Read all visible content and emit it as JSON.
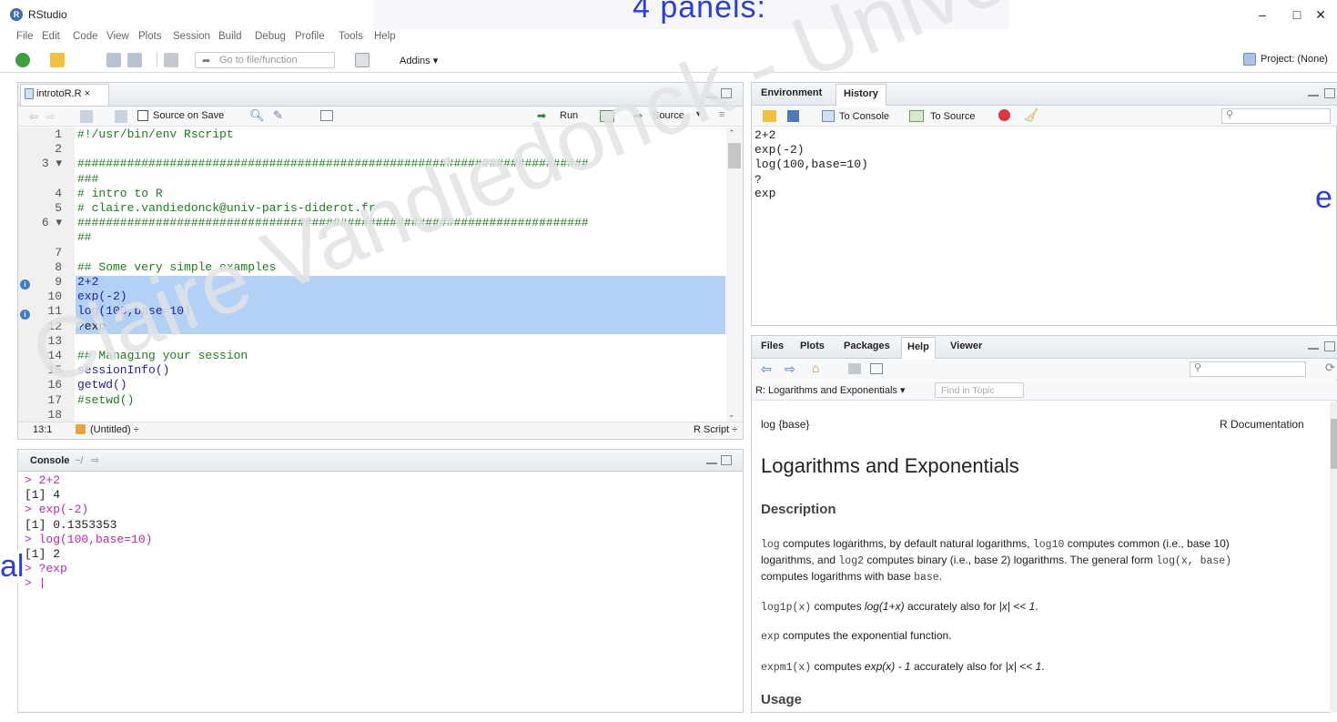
{
  "window": {
    "title": "RStudio",
    "app_icon": "R",
    "overlay_title": "4 panels:",
    "minimize": "–",
    "maximize": "□",
    "close": "✕"
  },
  "watermark": "Claire Vandiedonck - Unive",
  "annotations": {
    "right_fragment": "e",
    "left_fragment": "al"
  },
  "menu": [
    "File",
    "Edit",
    "Code",
    "View",
    "Plots",
    "Session",
    "Build",
    "Debug",
    "Profile",
    "Tools",
    "Help"
  ],
  "toolbar": {
    "goto_placeholder": "Go to file/function",
    "addins": "Addins ▾",
    "project": "Project: (None)"
  },
  "editor": {
    "tab_label": "introtoR.R ×",
    "source_on_save": "Source on Save",
    "run": "Run",
    "source": "Source",
    "status_pos": "13:1",
    "status_scope": "(Untitled) ÷",
    "status_type": "R Script ÷",
    "lines": [
      {
        "n": "1",
        "text": "#!/usr/bin/env Rscript",
        "kind": "comment"
      },
      {
        "n": "2",
        "text": "",
        "kind": "plain"
      },
      {
        "n": "3 ▾",
        "text": "########################################################################",
        "kind": "comment"
      },
      {
        "n": "",
        "text": "###",
        "kind": "comment"
      },
      {
        "n": "4",
        "text": "# intro to R",
        "kind": "comment"
      },
      {
        "n": "5",
        "text": "# claire.vandiedonck@univ-paris-diderot.fr",
        "kind": "comment"
      },
      {
        "n": "6 ▾",
        "text": "########################################################################",
        "kind": "comment"
      },
      {
        "n": "",
        "text": "##",
        "kind": "comment"
      },
      {
        "n": "7",
        "text": "",
        "kind": "plain"
      },
      {
        "n": "8",
        "text": "## Some very simple examples",
        "kind": "comment"
      },
      {
        "n": "9",
        "text": "2+2",
        "kind": "fn"
      },
      {
        "n": "10",
        "text": "exp(-2)",
        "kind": "fn"
      },
      {
        "n": "11",
        "text": "log(100,base=10)",
        "kind": "fn"
      },
      {
        "n": "12",
        "text": "?exp",
        "kind": "plain"
      },
      {
        "n": "13",
        "text": "",
        "kind": "plain"
      },
      {
        "n": "14",
        "text": "## Managing your session",
        "kind": "comment"
      },
      {
        "n": "15",
        "text": "sessionInfo()",
        "kind": "fn"
      },
      {
        "n": "16",
        "text": "getwd()",
        "kind": "fn"
      },
      {
        "n": "17",
        "text": "#setwd()",
        "kind": "comment"
      },
      {
        "n": "18",
        "text": "",
        "kind": "plain"
      }
    ]
  },
  "console": {
    "tab_label": "Console",
    "path": "~/",
    "lines": [
      {
        "text": "> 2+2",
        "kind": "in"
      },
      {
        "text": "[1] 4",
        "kind": "out"
      },
      {
        "text": "> exp(-2)",
        "kind": "in"
      },
      {
        "text": "[1] 0.1353353",
        "kind": "out"
      },
      {
        "text": "> log(100,base=10)",
        "kind": "in"
      },
      {
        "text": "[1] 2",
        "kind": "out"
      },
      {
        "text": "> ?exp",
        "kind": "in"
      },
      {
        "text": "> |",
        "kind": "in"
      }
    ]
  },
  "env": {
    "tabs": [
      "Environment",
      "History"
    ],
    "to_console": "To Console",
    "to_source": "To Source",
    "history": [
      "2+2",
      "exp(-2)",
      "log(100,base=10)",
      "?exp"
    ]
  },
  "help": {
    "tabs": [
      "Files",
      "Plots",
      "Packages",
      "Help",
      "Viewer"
    ],
    "topic": "R: Logarithms and Exponentials ▾",
    "find_placeholder": "Find in Topic",
    "doc_left": "log {base}",
    "doc_right": "R Documentation",
    "title": "Logarithms and Exponentials",
    "description_heading": "Description",
    "p1_a": "log",
    "p1_b": " computes logarithms, by default natural logarithms, ",
    "p1_c": "log10",
    "p1_d": " computes common (i.e., base 10)",
    "p1_e": "logarithms, and ",
    "p1_f": "log2",
    "p1_g": " computes binary (i.e., base 2) logarithms. The general form ",
    "p1_h": "log(x, base)",
    "p1_i": "computes logarithms with base ",
    "p1_j": "base",
    "p1_k": ".",
    "p2_a": "log1p(x)",
    "p2_b": " computes ",
    "p2_c": "log(1+x)",
    "p2_d": " accurately also for ",
    "p2_e": "|x| << 1",
    "p2_f": ".",
    "p3_a": "exp",
    "p3_b": " computes the exponential function.",
    "p4_a": "expm1(x)",
    "p4_b": " computes ",
    "p4_c": "exp(x) - 1",
    "p4_d": " accurately also for ",
    "p4_e": "|x| << 1",
    "p4_f": ".",
    "usage_heading": "Usage"
  }
}
